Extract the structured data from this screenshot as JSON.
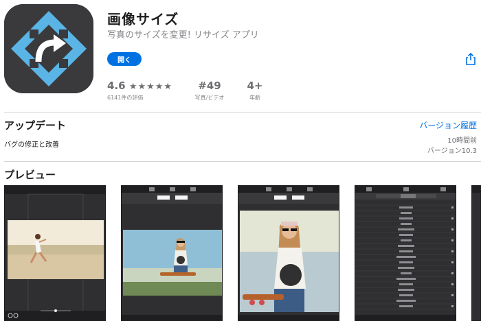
{
  "app": {
    "title": "画像サイズ",
    "subtitle": "写真のサイズを変更! リサイズ アプリ",
    "open_label": "開く"
  },
  "stats": {
    "rating": "4.6",
    "stars": "★★★★★",
    "rating_count": "6141件の評価",
    "rank": "#49",
    "rank_label": "写真/ビデオ",
    "age": "4+",
    "age_label": "年齢"
  },
  "update": {
    "title": "アップデート",
    "history_link": "バージョン履歴",
    "note": "バグの修正と改善",
    "time_ago": "10時間前",
    "version": "バージョン10.3"
  },
  "preview": {
    "title": "プレビュー"
  },
  "colors": {
    "accent": "#0071e3",
    "icon_bg": "#3a3a3c",
    "icon_blue": "#5ab4e5"
  },
  "icons": {
    "share": "share-icon",
    "app": "resize-arrow-app-icon"
  }
}
